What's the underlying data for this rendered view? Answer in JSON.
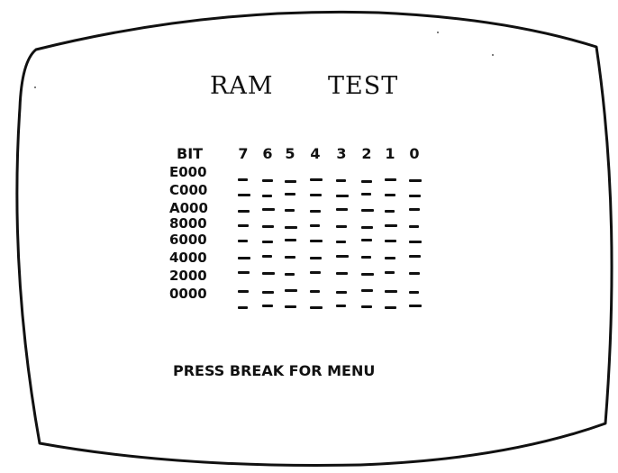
{
  "screen": {
    "title_left": "RAM",
    "title_right": "TEST",
    "bit_label": "BIT",
    "bits": [
      "7",
      "6",
      "5",
      "4",
      "3",
      "2",
      "1",
      "0"
    ],
    "addresses": [
      "E000",
      "C000",
      "A000",
      "8000",
      "6000",
      "4000",
      "2000",
      "0000"
    ],
    "cell_status": "-",
    "prompt": "PRESS BREAK FOR MENU"
  },
  "colors": {
    "background": "#ffffff",
    "foreground": "#111111"
  }
}
